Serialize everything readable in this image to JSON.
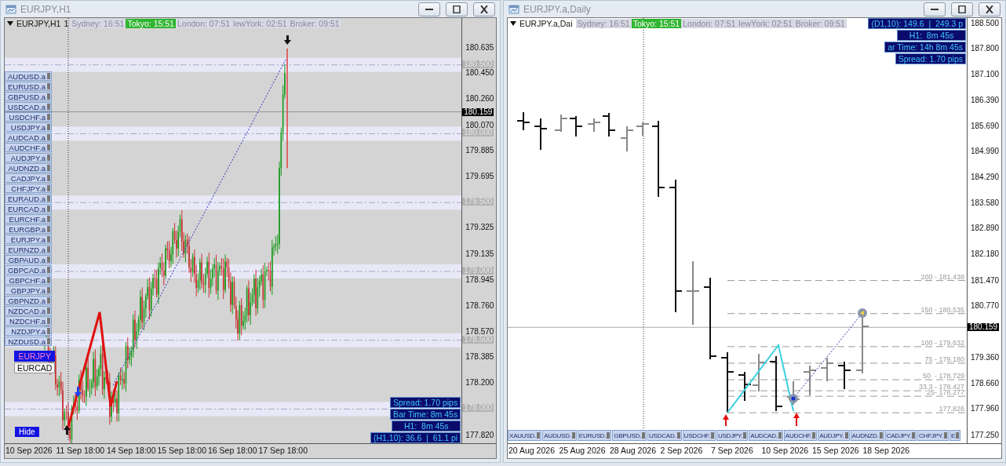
{
  "windows": [
    {
      "title": "EURJPY,H1",
      "symbol": "EURJPY,H1",
      "header_extra": "1",
      "sessions": [
        {
          "label": "Sydney: 16:51",
          "active": false
        },
        {
          "label": "Tokyo: 15:51",
          "active": true
        },
        {
          "label": "London: 07:51",
          "active": false
        },
        {
          "label": "lewYork: 02:51",
          "active": false
        },
        {
          "label": "Broker: 09:51",
          "active": false
        }
      ],
      "price_axis": [
        "180.635",
        "180.450",
        "180.260",
        "180.070",
        "179.885",
        "179.695",
        "179.325",
        "179.135",
        "178.945",
        "178.760",
        "178.570",
        "178.385",
        "178.200",
        "177.820"
      ],
      "level_tags": [
        "180.500",
        "180.000",
        "179.500",
        "179.000",
        "178.500",
        "178.000"
      ],
      "current_price": "180.159",
      "time_axis": [
        "10 Sep 2026",
        "11 Sep 18:00",
        "14 Sep 18:00",
        "15 Sep 18:00",
        "16 Sep 18:00",
        "17 Sep 18:00"
      ],
      "info_panel": [
        "Spread: 1.70 pips",
        "Bar Time: 8m 45s",
        "H1:  8m 45s",
        "(H1,10): 36.6  |  61.1 pi"
      ],
      "symbol_buttons": [
        "AUDUSD.a",
        "EURUSD.a",
        "GBPUSD.a",
        "USDCAD.a",
        "USDCHF.a",
        "USDJPY.a",
        "AUDCAD.a",
        "AUDCHF.a",
        "AUDJPY.a",
        "AUDNZD.a",
        "CADJPY.a",
        "CHFJPY.a",
        "EURAUD.a",
        "EURCAD.a",
        "EURCHF.a",
        "EURGBP.a",
        "EURJPY.a",
        "EURNZD.a",
        "GBPAUD.a",
        "GBPCAD.a",
        "GBPCHF.a",
        "GBPJPY.a",
        "GBPNZD.a",
        "NZDCAD.a",
        "NZDCHF.a",
        "NZDJPY.a",
        "NZDUSD.a"
      ],
      "chart_buttons": [
        {
          "label": "EURJPY",
          "selected": true
        },
        {
          "label": "EURCAD",
          "selected": false
        }
      ],
      "hide_button": "Hide"
    },
    {
      "title": "EURJPY.a,Daily",
      "symbol": "EURJPY.a,Dai",
      "sessions": [
        {
          "label": "Sydney: 16:51",
          "active": false
        },
        {
          "label": "Tokyo: 15:51",
          "active": true
        },
        {
          "label": "London: 07:51",
          "active": false
        },
        {
          "label": "lewYork: 02:51",
          "active": false
        },
        {
          "label": "Broker: 09:51",
          "active": false
        }
      ],
      "price_axis": [
        "188.500",
        "187.800",
        "187.100",
        "186.390",
        "185.690",
        "184.990",
        "184.290",
        "183.580",
        "182.890",
        "182.180",
        "181.470",
        "180.770",
        "179.360",
        "178.660",
        "177.960",
        "177.250"
      ],
      "current_price": "180.159",
      "time_axis": [
        "20 Aug 2026",
        "25 Aug 2026",
        "28 Aug 2026",
        "2 Sep 2026",
        "7 Sep 2026",
        "10 Sep 2026",
        "15 Sep 2026",
        "18 Sep 2026"
      ],
      "info_panel": [
        "(D1,10): 149.6  |  249.3 p",
        "H1:  8m 45s",
        "ar Time: 14h 8m 45s",
        "Spread: 1.70 pips"
      ],
      "fib_levels": [
        "200 - 181.438",
        "150 - 180.535",
        "100 - 179.632",
        "75 - 179.180",
        "50  - 178.729",
        "33.3 - 178.427",
        "25- 178.277",
        "177.826"
      ],
      "symbol_tabs": [
        "XAUUSD.",
        "AUDUSD.",
        "EURUSD.",
        "GBPUSD.",
        "USDCAD.",
        "USDCHF.",
        "USDJPY.",
        "AUDCAD.",
        "AUDCHF.",
        "AUDJPY.",
        "AUDNZD.",
        "CADJPY.",
        "CHFJPY.",
        "E"
      ]
    }
  ]
}
